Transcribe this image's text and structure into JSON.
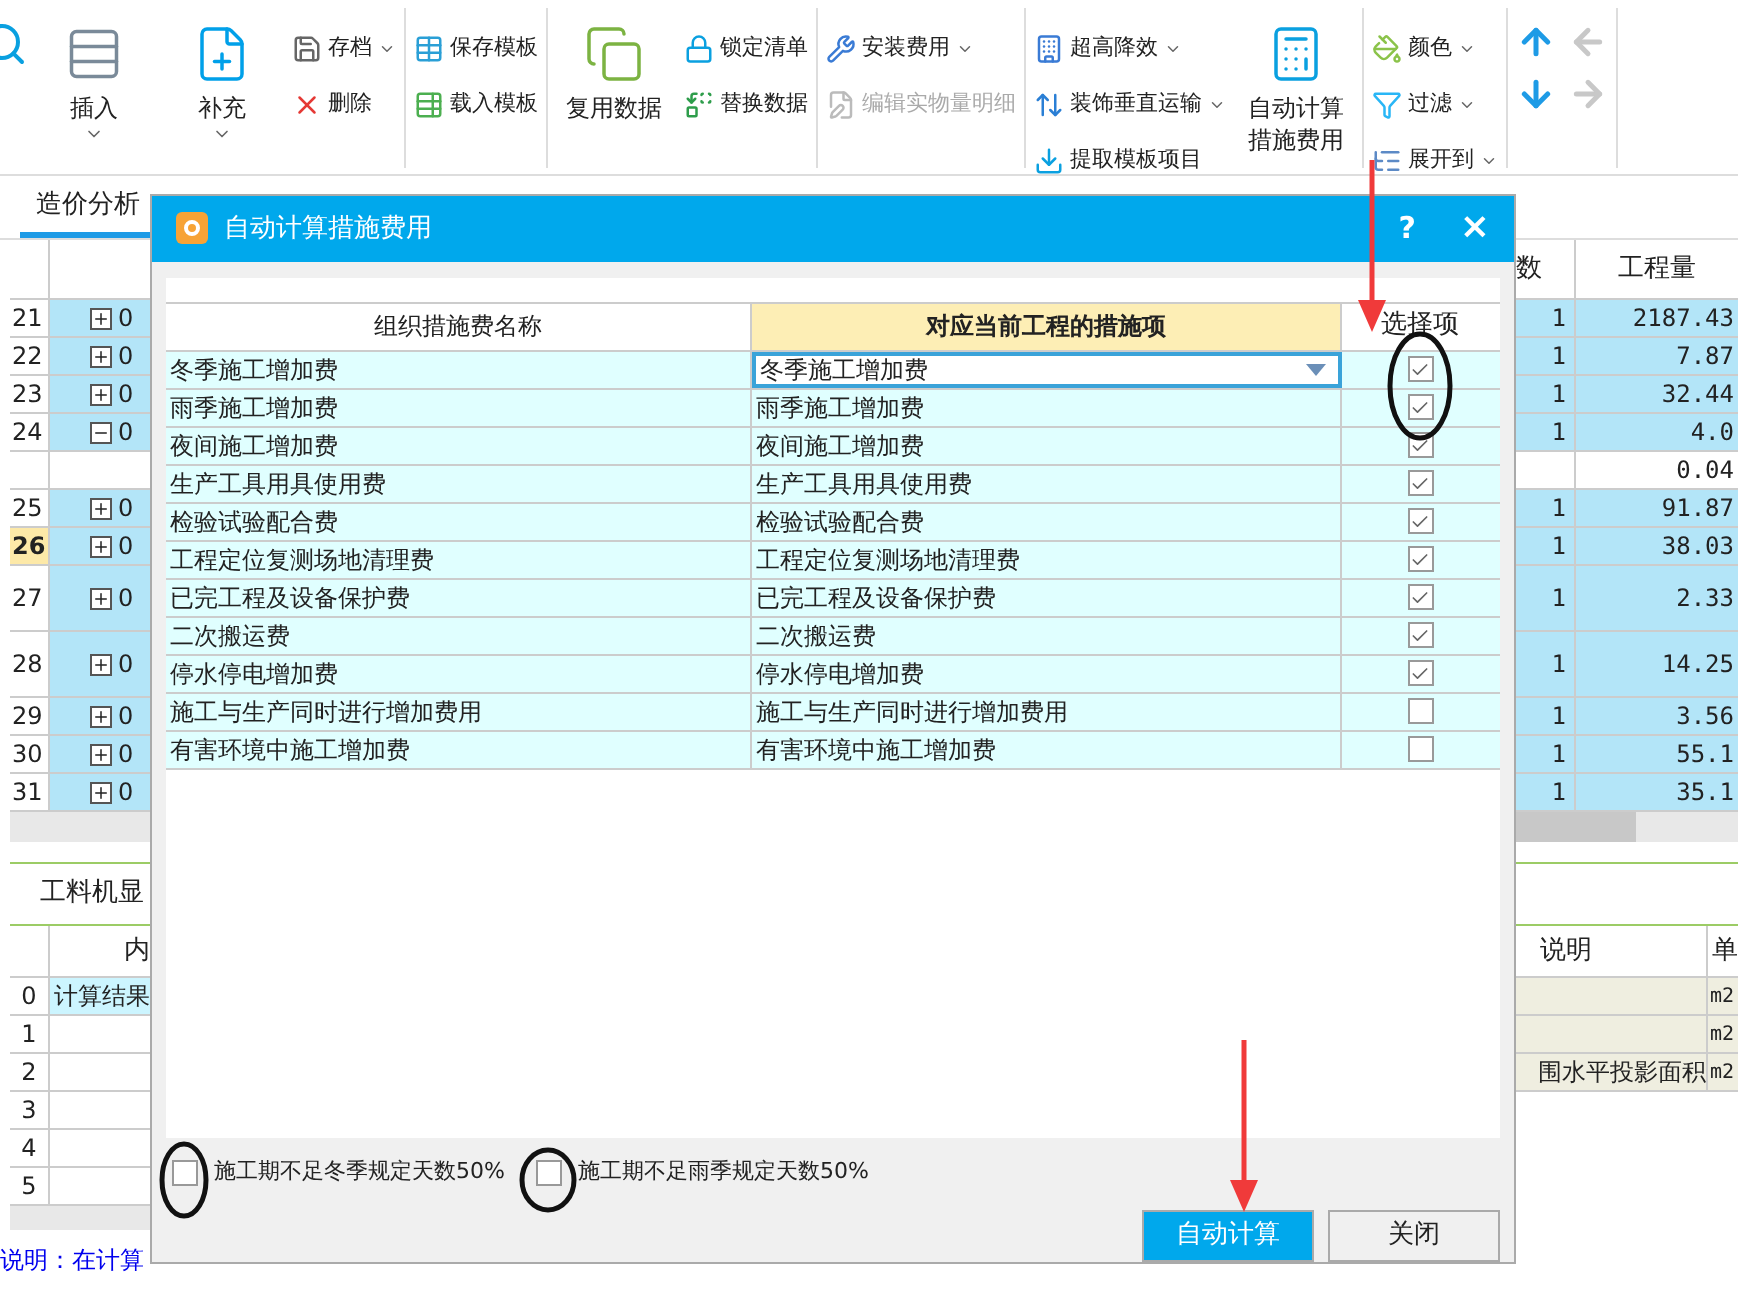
{
  "ribbon": [
    {
      "columns": [
        {
          "items": [
            {
              "kind": "large",
              "label": "插入",
              "dropdown": true,
              "disabled": false
            }
          ]
        },
        {
          "items": [
            {
              "kind": "large",
              "label": "补充",
              "dropdown": true,
              "disabled": false
            }
          ]
        },
        {
          "items": [
            {
              "kind": "small",
              "label": "存档",
              "dropdown": true,
              "disabled": false
            },
            {
              "kind": "small",
              "label": "删除",
              "dropdown": false,
              "disabled": false
            }
          ]
        }
      ]
    },
    {
      "columns": [
        {
          "items": [
            {
              "kind": "small",
              "label": "保存模板",
              "dropdown": false,
              "disabled": false
            },
            {
              "kind": "small",
              "label": "载入模板",
              "dropdown": false,
              "disabled": false
            }
          ]
        }
      ]
    },
    {
      "columns": [
        {
          "items": [
            {
              "kind": "large",
              "label": "复用数据",
              "dropdown": false,
              "disabled": false
            }
          ]
        },
        {
          "items": [
            {
              "kind": "small",
              "label": "锁定清单",
              "dropdown": false,
              "disabled": false
            },
            {
              "kind": "small",
              "label": "替换数据",
              "dropdown": false,
              "disabled": false
            }
          ]
        }
      ]
    },
    {
      "columns": [
        {
          "items": [
            {
              "kind": "small",
              "label": "安装费用",
              "dropdown": true,
              "disabled": false
            },
            {
              "kind": "small",
              "label": "编辑实物量明细",
              "dropdown": false,
              "disabled": true
            }
          ]
        }
      ]
    },
    {
      "columns": [
        {
          "items": [
            {
              "kind": "small",
              "label": "超高降效",
              "dropdown": true,
              "disabled": false
            },
            {
              "kind": "small",
              "label": "装饰垂直运输",
              "dropdown": true,
              "disabled": false
            },
            {
              "kind": "small",
              "label": "提取模板项目",
              "dropdown": false,
              "disabled": false
            }
          ]
        },
        {
          "items": [
            {
              "kind": "large",
              "label": "自动计算措施费用",
              "dropdown": false,
              "disabled": false
            }
          ]
        }
      ]
    },
    {
      "columns": [
        {
          "items": [
            {
              "kind": "small",
              "label": "颜色",
              "dropdown": true,
              "disabled": false
            },
            {
              "kind": "small",
              "label": "过滤",
              "dropdown": true,
              "disabled": false
            },
            {
              "kind": "small",
              "label": "展开到",
              "dropdown": true,
              "disabled": false
            }
          ]
        }
      ]
    },
    {
      "columns": [
        {
          "items": [
            {
              "kind": "arrow",
              "disabled": false
            },
            {
              "kind": "arrow",
              "disabled": false
            }
          ]
        },
        {
          "items": [
            {
              "kind": "arrow",
              "disabled": true
            },
            {
              "kind": "arrow",
              "disabled": true
            }
          ]
        }
      ]
    }
  ],
  "tabs": [
    {
      "label": "造价分析",
      "selected": true
    }
  ],
  "main_table": {
    "columns": [
      "数",
      "工程量"
    ],
    "rows": [
      {
        "kind": "normal",
        "number": "21",
        "expanded": false,
        "code": "0",
        "count": "1",
        "quantity": "2187.43",
        "selected": false
      },
      {
        "kind": "normal",
        "number": "22",
        "expanded": false,
        "code": "0",
        "count": "1",
        "quantity": "7.87",
        "selected": false
      },
      {
        "kind": "normal",
        "number": "23",
        "expanded": false,
        "code": "0",
        "count": "1",
        "quantity": "32.44",
        "selected": false
      },
      {
        "kind": "normal",
        "number": "24",
        "expanded": true,
        "code": "0",
        "count": "1",
        "quantity": "4.0",
        "selected": false
      },
      {
        "kind": "detail",
        "quantity": "0.04"
      },
      {
        "kind": "normal",
        "number": "25",
        "expanded": false,
        "code": "0",
        "count": "1",
        "quantity": "91.87",
        "selected": false
      },
      {
        "kind": "normal",
        "number": "26",
        "expanded": false,
        "code": "0",
        "count": "1",
        "quantity": "38.03",
        "selected": true
      },
      {
        "kind": "wrapped",
        "number": "27",
        "expanded": false,
        "code": "0",
        "count": "1",
        "quantity": "2.33",
        "selected": false
      },
      {
        "kind": "wrapped",
        "number": "28",
        "expanded": false,
        "code": "0",
        "count": "1",
        "quantity": "14.25",
        "selected": false
      },
      {
        "kind": "normal",
        "number": "29",
        "expanded": false,
        "code": "0",
        "count": "1",
        "quantity": "3.56",
        "selected": false
      },
      {
        "kind": "normal",
        "number": "30",
        "expanded": false,
        "code": "0",
        "count": "1",
        "quantity": "55.1",
        "selected": false
      },
      {
        "kind": "normal",
        "number": "31",
        "expanded": false,
        "code": "0",
        "count": "1",
        "quantity": "35.1",
        "selected": false
      }
    ]
  },
  "bottom_tabs": [
    {
      "label": "工料机显",
      "selected": true
    }
  ],
  "bottom_table": {
    "columns": [
      "内",
      "说明",
      "单"
    ],
    "rows": [
      {
        "number": "0",
        "content": "计算结果",
        "note": "",
        "unit": "m2"
      },
      {
        "number": "1",
        "content": "",
        "note": "",
        "unit": "m2"
      },
      {
        "number": "2",
        "content": "",
        "note": "围水平投影面积",
        "unit": "m2"
      },
      {
        "number": "3",
        "content": "",
        "note": "",
        "unit": ""
      },
      {
        "number": "4",
        "content": "",
        "note": "",
        "unit": ""
      },
      {
        "number": "5",
        "content": "",
        "note": "",
        "unit": ""
      }
    ]
  },
  "footer": "说明：在计算",
  "dialog": {
    "title": "自动计算措施费用",
    "help": "?",
    "close": "×",
    "columns": [
      "组织措施费名称",
      "对应当前工程的措施项",
      "选择项"
    ],
    "rows": [
      {
        "name": "冬季施工增加费",
        "mapped": "冬季施工增加费",
        "checked": true,
        "selected": true
      },
      {
        "name": "雨季施工增加费",
        "mapped": "雨季施工增加费",
        "checked": true,
        "selected": false
      },
      {
        "name": "夜间施工增加费",
        "mapped": "夜间施工增加费",
        "checked": true,
        "selected": false
      },
      {
        "name": "生产工具用具使用费",
        "mapped": "生产工具用具使用费",
        "checked": true,
        "selected": false
      },
      {
        "name": "检验试验配合费",
        "mapped": "检验试验配合费",
        "checked": true,
        "selected": false
      },
      {
        "name": "工程定位复测场地清理费",
        "mapped": "工程定位复测场地清理费",
        "checked": true,
        "selected": false
      },
      {
        "name": "已完工程及设备保护费",
        "mapped": "已完工程及设备保护费",
        "checked": true,
        "selected": false
      },
      {
        "name": "二次搬运费",
        "mapped": "二次搬运费",
        "checked": true,
        "selected": false
      },
      {
        "name": "停水停电增加费",
        "mapped": "停水停电增加费",
        "checked": true,
        "selected": false
      },
      {
        "name": "施工与生产同时进行增加费用",
        "mapped": "施工与生产同时进行增加费用",
        "checked": false,
        "selected": false
      },
      {
        "name": "有害环境中施工增加费",
        "mapped": "有害环境中施工增加费",
        "checked": false,
        "selected": false
      }
    ],
    "options": [
      {
        "label": "施工期不足冬季规定天数50%",
        "checked": false
      },
      {
        "label": "施工期不足雨季规定天数50%",
        "checked": false
      }
    ],
    "buttons": [
      {
        "label": "自动计算",
        "primary": true
      },
      {
        "label": "关闭",
        "primary": false
      }
    ]
  }
}
